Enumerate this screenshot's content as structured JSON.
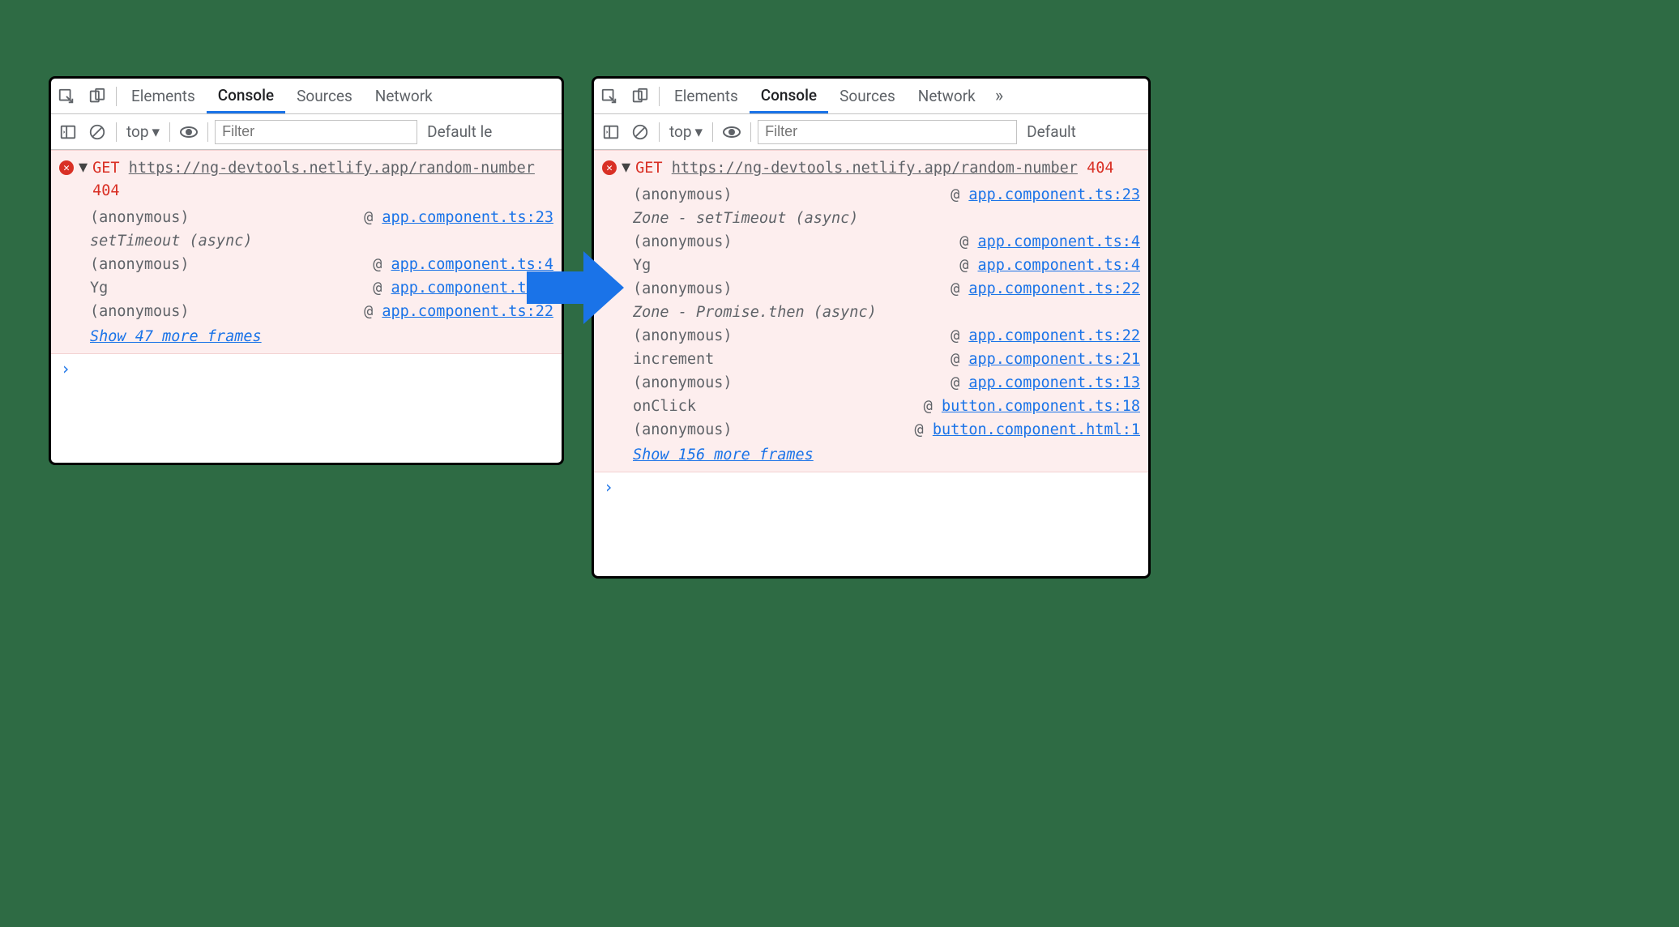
{
  "tabs": {
    "elements": "Elements",
    "console": "Console",
    "sources": "Sources",
    "network": "Network",
    "more": "»"
  },
  "toolbar": {
    "context": "top",
    "filter_placeholder": "Filter",
    "levels_left": "Default le",
    "levels_right": "Default"
  },
  "left": {
    "method": "GET",
    "url": "https://ng-devtools.netlify.app/random-number",
    "status": "404",
    "frames": [
      {
        "type": "frame",
        "fn": "(anonymous)",
        "loc": "app.component.ts:23"
      },
      {
        "type": "async",
        "label": "setTimeout (async)"
      },
      {
        "type": "frame",
        "fn": "(anonymous)",
        "loc": "app.component.ts:4"
      },
      {
        "type": "frame",
        "fn": "Yg",
        "loc": "app.component.ts:4"
      },
      {
        "type": "frame",
        "fn": "(anonymous)",
        "loc": "app.component.ts:22"
      }
    ],
    "more": "Show 47 more frames"
  },
  "right": {
    "method": "GET",
    "url": "https://ng-devtools.netlify.app/random-number",
    "status": "404",
    "frames": [
      {
        "type": "frame",
        "fn": "(anonymous)",
        "loc": "app.component.ts:23"
      },
      {
        "type": "async",
        "label": "Zone - setTimeout (async)"
      },
      {
        "type": "frame",
        "fn": "(anonymous)",
        "loc": "app.component.ts:4"
      },
      {
        "type": "frame",
        "fn": "Yg",
        "loc": "app.component.ts:4"
      },
      {
        "type": "frame",
        "fn": "(anonymous)",
        "loc": "app.component.ts:22"
      },
      {
        "type": "async",
        "label": "Zone - Promise.then (async)"
      },
      {
        "type": "frame",
        "fn": "(anonymous)",
        "loc": "app.component.ts:22"
      },
      {
        "type": "frame",
        "fn": "increment",
        "loc": "app.component.ts:21"
      },
      {
        "type": "frame",
        "fn": "(anonymous)",
        "loc": "app.component.ts:13"
      },
      {
        "type": "frame",
        "fn": "onClick",
        "loc": "button.component.ts:18"
      },
      {
        "type": "frame",
        "fn": "(anonymous)",
        "loc": "button.component.html:1"
      }
    ],
    "more": "Show 156 more frames"
  },
  "prompt": "›"
}
